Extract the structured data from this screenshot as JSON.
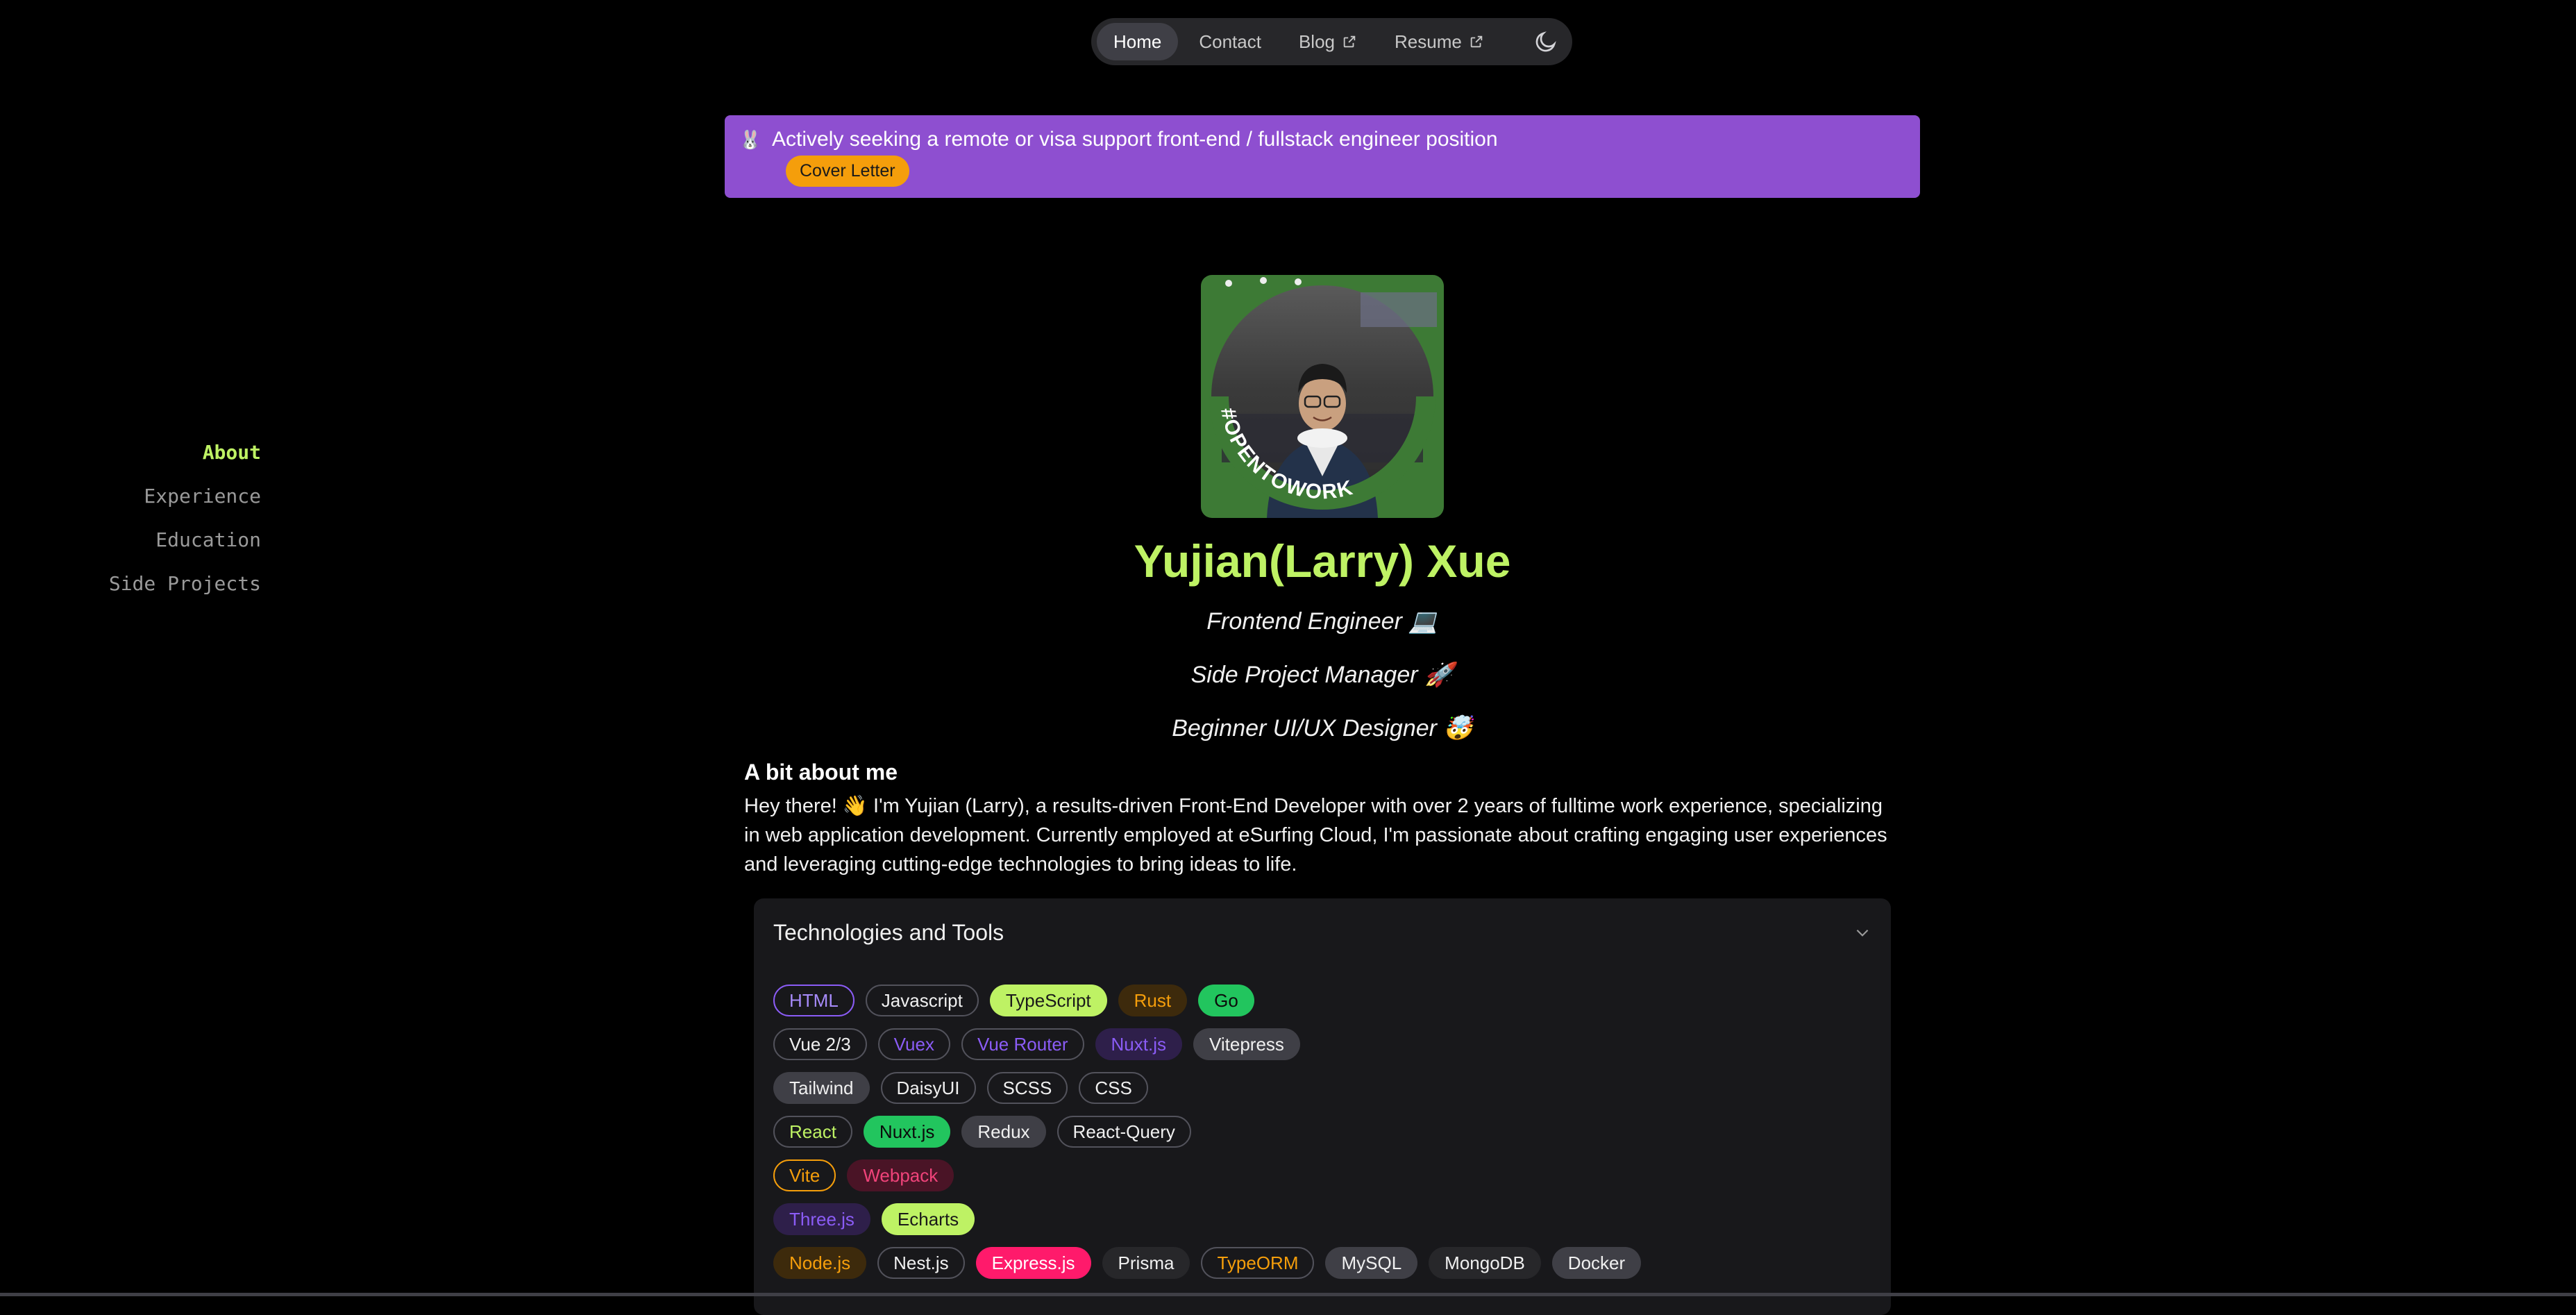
{
  "nav": {
    "items": [
      {
        "label": "Home",
        "active": true,
        "external": false
      },
      {
        "label": "Contact",
        "active": false,
        "external": false
      },
      {
        "label": "Blog",
        "active": false,
        "external": true
      },
      {
        "label": "Resume",
        "active": false,
        "external": true
      }
    ],
    "theme_toggle_icon": "moon-icon"
  },
  "banner": {
    "emoji": "🐰",
    "message": "Actively seeking a remote or visa support front-end / fullstack engineer position",
    "button_label": "Cover Letter",
    "background": "#8e4fd0",
    "button_color": "#f59e0b"
  },
  "sidenav": {
    "items": [
      {
        "label": "About",
        "active": true
      },
      {
        "label": "Experience",
        "active": false
      },
      {
        "label": "Education",
        "active": false
      },
      {
        "label": "Side Projects",
        "active": false
      }
    ]
  },
  "profile": {
    "avatar_badge": "#OPENTOWORK",
    "name": "Yujian(Larry) Xue",
    "roles": [
      "Frontend Engineer 💻",
      "Side Project Manager 🚀",
      "Beginner UI/UX Designer 🤯"
    ],
    "accent": "#bef264"
  },
  "about": {
    "title": "A bit about me",
    "text": "Hey there! 👋 I'm Yujian (Larry), a results-driven Front-End Developer with over 2 years of fulltime work experience, specializing in web application development. Currently employed at eSurfing Cloud, I'm passionate about crafting engaging user experiences and leveraging cutting-edge technologies to bring ideas to life."
  },
  "tech": {
    "title": "Technologies and Tools",
    "rows": [
      [
        {
          "label": "HTML",
          "style": "outline-purple"
        },
        {
          "label": "Javascript",
          "style": "outline-gray"
        },
        {
          "label": "TypeScript",
          "style": "lime"
        },
        {
          "label": "Rust",
          "style": "amber-soft"
        },
        {
          "label": "Go",
          "style": "green"
        }
      ],
      [
        {
          "label": "Vue 2/3",
          "style": "outline-gray"
        },
        {
          "label": "Vuex",
          "style": "outline-gray-purple"
        },
        {
          "label": "Vue Router",
          "style": "outline-gray-purple"
        },
        {
          "label": "Nuxt.js",
          "style": "purple-soft"
        },
        {
          "label": "Vitepress",
          "style": "gray"
        }
      ],
      [
        {
          "label": "Tailwind",
          "style": "gray"
        },
        {
          "label": "DaisyUI",
          "style": "outline-gray"
        },
        {
          "label": "SCSS",
          "style": "outline-gray"
        },
        {
          "label": "CSS",
          "style": "outline-gray"
        }
      ],
      [
        {
          "label": "React",
          "style": "outline-gray-lime"
        },
        {
          "label": "Nuxt.js",
          "style": "green"
        },
        {
          "label": "Redux",
          "style": "gray"
        },
        {
          "label": "React-Query",
          "style": "outline-gray"
        }
      ],
      [
        {
          "label": "Vite",
          "style": "outline-amber"
        },
        {
          "label": "Webpack",
          "style": "pink-soft"
        }
      ],
      [
        {
          "label": "Three.js",
          "style": "purple-soft"
        },
        {
          "label": "Echarts",
          "style": "lime"
        }
      ],
      [
        {
          "label": "Node.js",
          "style": "amber-soft"
        },
        {
          "label": "Nest.js",
          "style": "outline-gray"
        },
        {
          "label": "Express.js",
          "style": "pink"
        },
        {
          "label": "Prisma",
          "style": "dark"
        },
        {
          "label": "TypeORM",
          "style": "outline-gray-amber"
        },
        {
          "label": "MySQL",
          "style": "gray"
        },
        {
          "label": "MongoDB",
          "style": "dark"
        },
        {
          "label": "Docker",
          "style": "gray"
        }
      ]
    ]
  }
}
